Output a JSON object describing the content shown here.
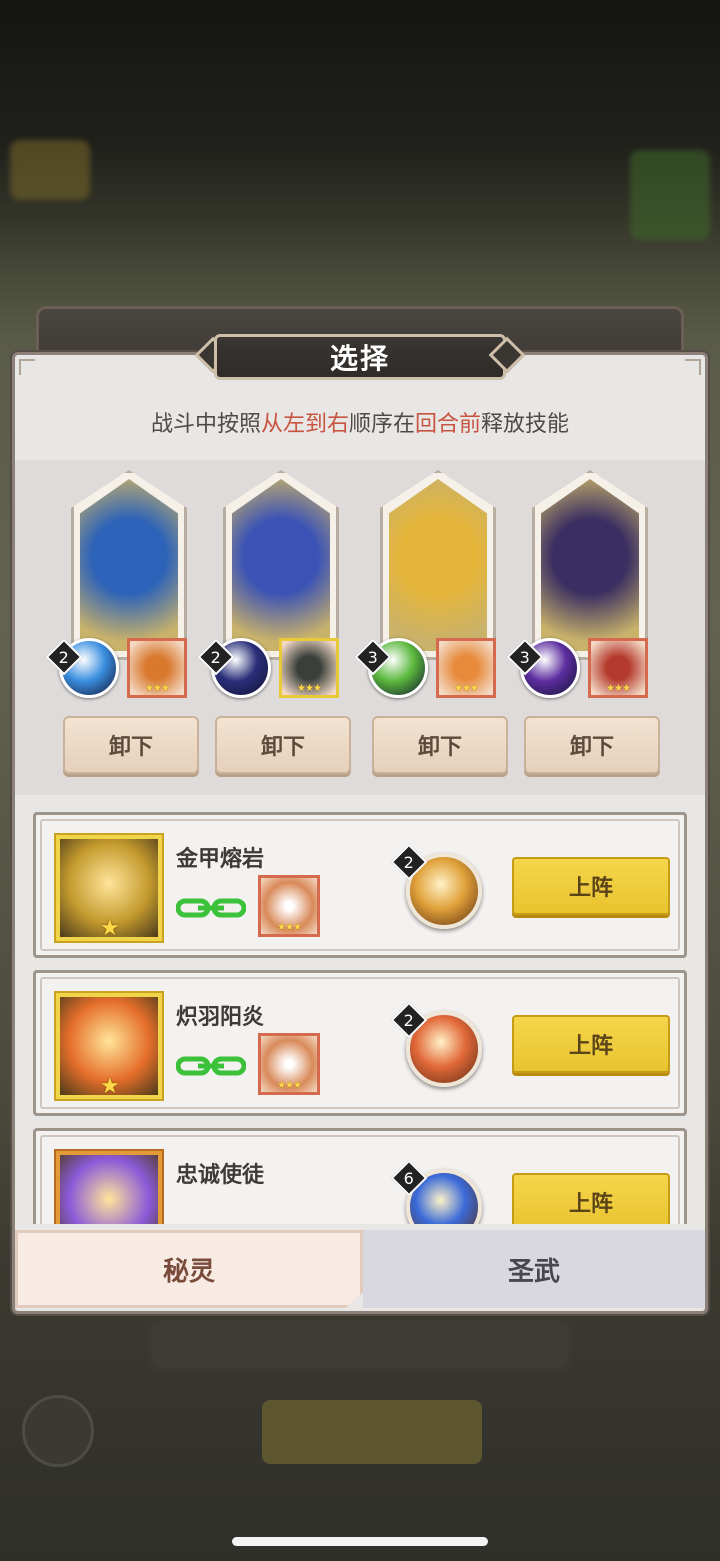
{
  "dialog": {
    "title": "选择",
    "hint_prefix": "战斗中按照",
    "hint_hl1": "从左到右",
    "hint_mid": "顺序在",
    "hint_hl2": "回合前",
    "hint_suffix": "释放技能"
  },
  "slots": [
    {
      "level": "2",
      "unload_label": "卸下",
      "art_color": "#2d63b8",
      "orb_color": "#3b8fe0",
      "pet_color": "#d9792e"
    },
    {
      "level": "2",
      "unload_label": "卸下",
      "art_color": "#3c53b5",
      "orb_color": "#2a2f7a",
      "pet_color": "#3a3f3a"
    },
    {
      "level": "3",
      "unload_label": "卸下",
      "art_color": "#e5b53a",
      "orb_color": "#5ab83c",
      "pet_color": "#e78a3a"
    },
    {
      "level": "3",
      "unload_label": "卸下",
      "art_color": "#3a2f62",
      "orb_color": "#5d2ea0",
      "pet_color": "#b53a2e"
    }
  ],
  "list": [
    {
      "name": "金甲熔岩",
      "level": "2",
      "deploy_label": "上阵",
      "skill_color": "#e0a13a",
      "portrait_color": "#c49a2e",
      "has_partner": true
    },
    {
      "name": "炽羽阳炎",
      "level": "2",
      "deploy_label": "上阵",
      "skill_color": "#e2693a",
      "portrait_color": "#e56e2a",
      "has_partner": true
    },
    {
      "name": "忠诚使徒",
      "level": "6",
      "deploy_label": "上阵",
      "skill_color": "#3a6ad8",
      "portrait_color": "#8b5ad8",
      "has_partner": false
    }
  ],
  "tabs": {
    "active_label": "秘灵",
    "inactive_label": "圣武"
  }
}
